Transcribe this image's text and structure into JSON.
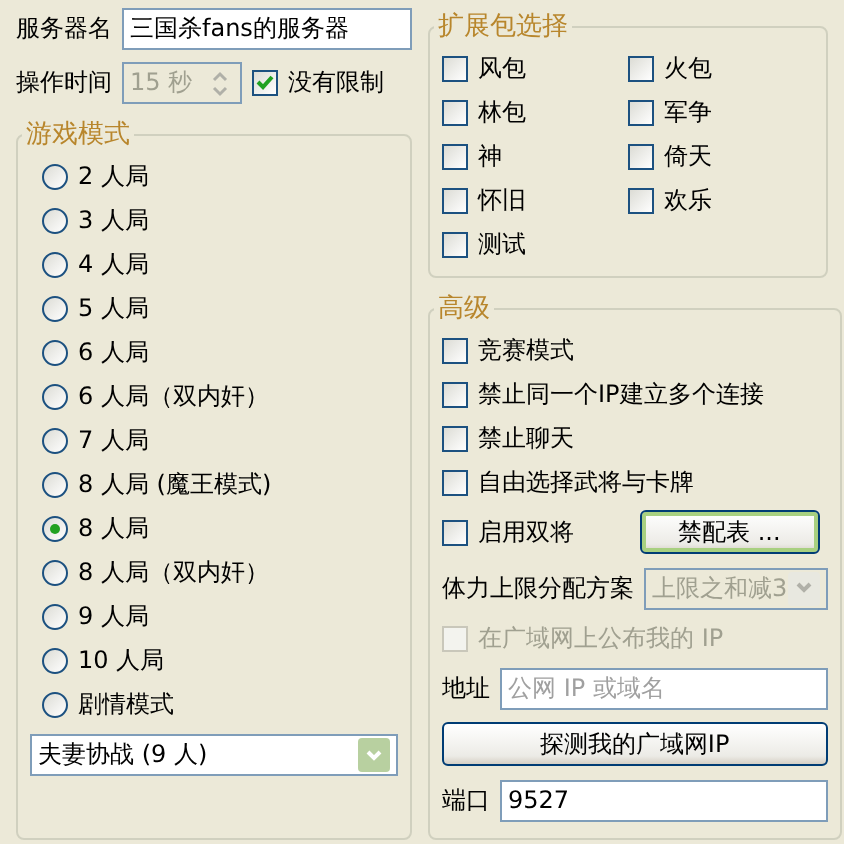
{
  "server_name": {
    "label": "服务器名",
    "value": "三国杀fans的服务器"
  },
  "operation_time": {
    "label": "操作时间",
    "value": "15 秒",
    "disabled": true
  },
  "no_limit": {
    "label": "没有限制",
    "checked": true
  },
  "game_mode": {
    "title": "游戏模式",
    "options": [
      {
        "label": "2 人局",
        "selected": false
      },
      {
        "label": "3 人局",
        "selected": false
      },
      {
        "label": "4 人局",
        "selected": false
      },
      {
        "label": "5 人局",
        "selected": false
      },
      {
        "label": "6 人局",
        "selected": false
      },
      {
        "label": "6 人局（双内奸）",
        "selected": false
      },
      {
        "label": "7 人局",
        "selected": false
      },
      {
        "label": "8 人局 (魔王模式)",
        "selected": false
      },
      {
        "label": "8 人局",
        "selected": true
      },
      {
        "label": "8 人局（双内奸）",
        "selected": false
      },
      {
        "label": "9 人局",
        "selected": false
      },
      {
        "label": "10 人局",
        "selected": false
      },
      {
        "label": "剧情模式",
        "selected": false
      }
    ],
    "scenario": {
      "value": "夫妻协战 (9 人)"
    }
  },
  "packages": {
    "title": "扩展包选择",
    "items": [
      {
        "label": "风包",
        "checked": false
      },
      {
        "label": "火包",
        "checked": false
      },
      {
        "label": "林包",
        "checked": false
      },
      {
        "label": "军争",
        "checked": false
      },
      {
        "label": "神",
        "checked": false
      },
      {
        "label": "倚天",
        "checked": false
      },
      {
        "label": "怀旧",
        "checked": false
      },
      {
        "label": "欢乐",
        "checked": false
      },
      {
        "label": "测试",
        "checked": false
      }
    ]
  },
  "advanced": {
    "title": "高级",
    "options": [
      {
        "label": "竞赛模式",
        "checked": false
      },
      {
        "label": "禁止同一个IP建立多个连接",
        "checked": false
      },
      {
        "label": "禁止聊天",
        "checked": false
      },
      {
        "label": "自由选择武将与卡牌",
        "checked": false
      }
    ],
    "dual_general": {
      "label": "启用双将",
      "checked": false
    },
    "ban_button": "禁配表 ...",
    "hp_scheme": {
      "label": "体力上限分配方案",
      "value": "上限之和减3",
      "disabled": true
    },
    "publish_ip": {
      "label": "在广域网上公布我的 IP",
      "checked": false,
      "disabled": true
    },
    "address": {
      "label": "地址",
      "placeholder": "公网 IP 或域名"
    },
    "detect_button": "探测我的广域网IP",
    "port": {
      "label": "端口",
      "value": "9527"
    }
  }
}
